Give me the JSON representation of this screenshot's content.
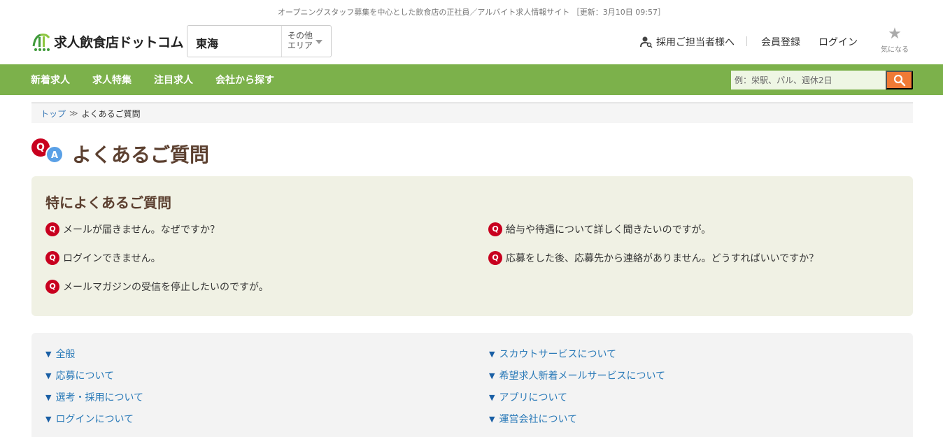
{
  "header": {
    "tagline": "オープニングスタッフ募集を中心とした飲食店の正社員／アルバイト求人情報サイト ［更新：3月10日 09:57］",
    "logo_text": "求人飲食店ドットコム",
    "area": {
      "current": "東海",
      "other_label": "その他エリア"
    },
    "links": {
      "employer": "採用ご担当者様へ",
      "register": "会員登録",
      "login": "ログイン",
      "favorites": "気になる"
    }
  },
  "nav": {
    "items": [
      "新着求人",
      "求人特集",
      "注目求人",
      "会社から探す"
    ],
    "search_placeholder": "例：栄駅、パル、週休2日"
  },
  "breadcrumb": {
    "top": "トップ",
    "separator": "≫",
    "current": "よくあるご質問"
  },
  "page": {
    "title": "よくあるご質問",
    "q_icon": "Q",
    "a_icon": "A"
  },
  "faq": {
    "title": "特によくあるご質問",
    "badge": "Q",
    "left": [
      "メールが届きません。なぜですか？",
      "ログインできません。",
      "メールマガジンの受信を停止したいのですが。"
    ],
    "right": [
      "給与や待遇について詳しく聞きたいのですが。",
      "応募をした後、応募先から連絡がありません。どうすればいいですか？"
    ]
  },
  "categories": {
    "arrow": "▼",
    "left": [
      "全般",
      "応募について",
      "選考・採用について",
      "ログインについて"
    ],
    "right": [
      "スカウトサービスについて",
      "希望求人新着メールサービスについて",
      "アプリについて",
      "運営会社について"
    ]
  },
  "colors": {
    "nav_green": "#7cb14b",
    "search_orange": "#f07a35",
    "q_red": "#c8001f",
    "a_blue": "#5aa0e6",
    "link_blue": "#2a7ab8",
    "title_brown": "#5c4030"
  }
}
